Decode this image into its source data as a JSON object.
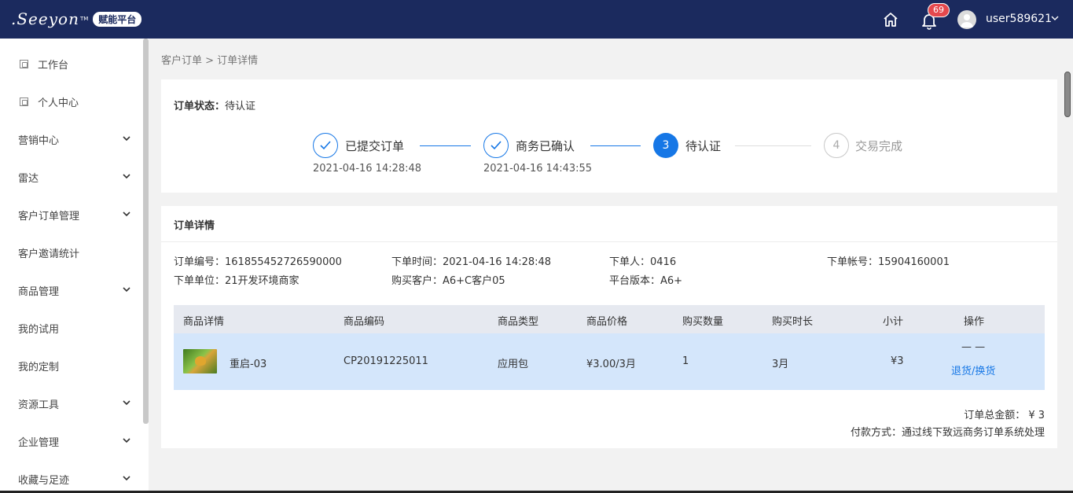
{
  "header": {
    "logo_text": ".Seeyon",
    "logo_tm": "TM",
    "platform_badge": "赋能平台",
    "notification_count": "69",
    "username": "user589621"
  },
  "sidebar": {
    "items": [
      {
        "label": "工作台",
        "icon": "page-icon",
        "expandable": false
      },
      {
        "label": "个人中心",
        "icon": "page-icon",
        "expandable": false
      },
      {
        "label": "营销中心",
        "expandable": true
      },
      {
        "label": "雷达",
        "expandable": true
      },
      {
        "label": "客户订单管理",
        "expandable": true
      },
      {
        "label": "客户邀请统计",
        "expandable": false
      },
      {
        "label": "商品管理",
        "expandable": true
      },
      {
        "label": "我的试用",
        "expandable": false
      },
      {
        "label": "我的定制",
        "expandable": false
      },
      {
        "label": "资源工具",
        "expandable": true
      },
      {
        "label": "企业管理",
        "expandable": true
      },
      {
        "label": "收藏与足迹",
        "expandable": true
      }
    ]
  },
  "breadcrumb": "客户订单 > 订单详情",
  "status": {
    "label": "订单状态：",
    "value": "待认证",
    "steps": [
      {
        "title": "已提交订单",
        "time": "2021-04-16 14:28:48",
        "state": "done"
      },
      {
        "title": "商务已确认",
        "time": "2021-04-16 14:43:55",
        "state": "done"
      },
      {
        "number": "3",
        "title": "待认证",
        "time": "",
        "state": "active"
      },
      {
        "number": "4",
        "title": "交易完成",
        "time": "",
        "state": "todo"
      }
    ]
  },
  "detail": {
    "title": "订单详情",
    "order_no": "订单编号：161855452726590000",
    "order_time": "下单时间：2021-04-16 14:28:48",
    "orderer": "下单人：0416",
    "account": "下单帐号：15904160001",
    "unit": "下单单位：21开发环境商家",
    "customer": "购买客户：A6+C客户05",
    "platform": "平台版本：A6+",
    "columns": [
      "商品详情",
      "商品编码",
      "商品类型",
      "商品价格",
      "购买数量",
      "购买时长",
      "小计",
      "操作"
    ],
    "rows": [
      {
        "name": "重启-03",
        "code": "CP20191225011",
        "type": "应用包",
        "price": "¥3.00/3月",
        "quantity": "1",
        "duration": "3月",
        "subtotal": "¥3",
        "op_dash": "— —",
        "op_link": "退货/换货"
      }
    ],
    "total": "订单总金额： ¥ 3",
    "payment": "付款方式：通过线下致远商务订单系统处理"
  },
  "colors": {
    "topbar": "#1b2a5e",
    "accent": "#1677e6",
    "row_highlight": "#d4e6fb",
    "badge": "#e5484d"
  }
}
